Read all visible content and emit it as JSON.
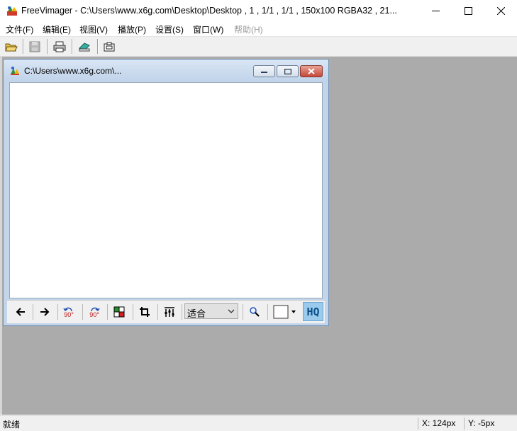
{
  "window": {
    "title": "FreeVimager - C:\\Users\\www.x6g.com\\Desktop\\Desktop , 1 , 1/1 , 1/1 , 150x100 RGBA32 , 21..."
  },
  "menu": {
    "items": [
      "文件(F)",
      "编辑(E)",
      "视图(V)",
      "播放(P)",
      "设置(S)",
      "窗口(W)",
      "帮助(H)"
    ]
  },
  "toolbar": {
    "icons": [
      "open-folder-icon",
      "save-icon",
      "print-icon",
      "scan-icon",
      "capture-icon"
    ]
  },
  "child_window": {
    "title": "C:\\Users\\www.x6g.com\\..."
  },
  "image_toolbar": {
    "rotate_ccw_label": "90°",
    "rotate_cw_label": "90°",
    "zoom_value": "适合",
    "hq_label": "HQ"
  },
  "status": {
    "left": "就绪",
    "x": "X: 124px",
    "y": "Y: -5px"
  },
  "colors": {
    "mdi_background": "#ababab",
    "hq_active": "#9bcaec",
    "close_button": "#c4473a"
  }
}
